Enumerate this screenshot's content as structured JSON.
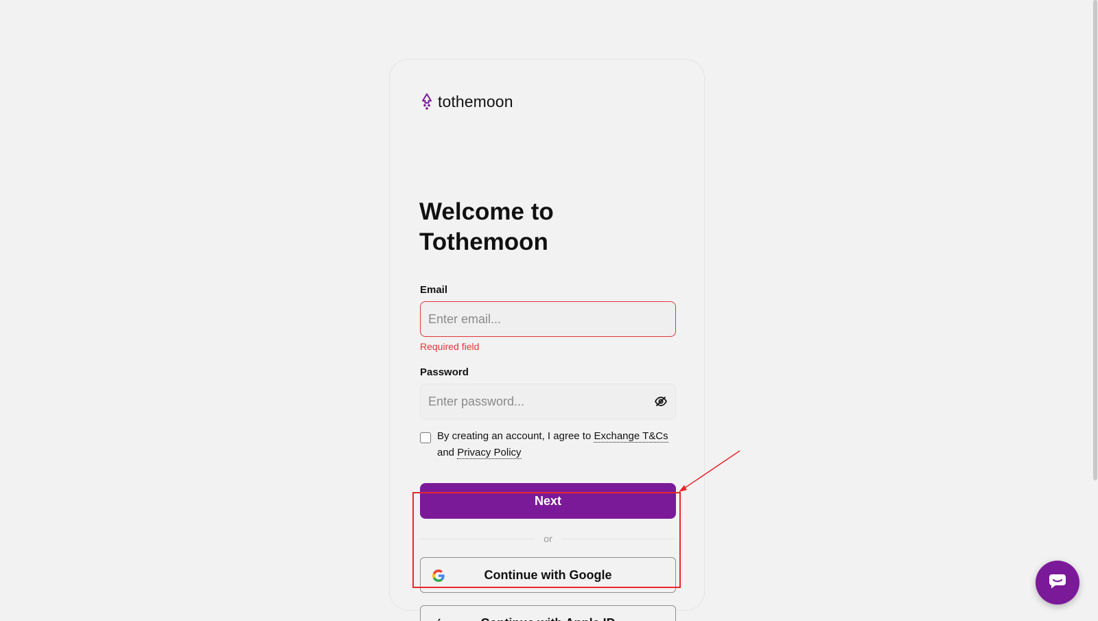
{
  "brand": {
    "name": "tothemoon",
    "accent_color": "#7b1a99",
    "error_color": "#e0363b"
  },
  "heading": {
    "line1": "Welcome to",
    "line2": "Tothemoon"
  },
  "form": {
    "email": {
      "label": "Email",
      "placeholder": "Enter email...",
      "value": "",
      "error": "Required field"
    },
    "password": {
      "label": "Password",
      "placeholder": "Enter password...",
      "value": "",
      "visibility_icon": "eye-off-icon"
    },
    "terms": {
      "checked": false,
      "text_before": "By creating an account, I agree to ",
      "link1": "Exchange T&Cs",
      "text_middle": " and ",
      "link2": "Privacy Policy"
    },
    "next_label": "Next"
  },
  "divider_text": "or",
  "social": {
    "google_label": "Continue with Google",
    "google_icon": "google-icon",
    "apple_label": "Continue with Apple ID",
    "apple_icon": "apple-icon"
  },
  "annotation": {
    "highlight_color": "#e8262b"
  },
  "chat": {
    "icon": "chat-icon"
  }
}
